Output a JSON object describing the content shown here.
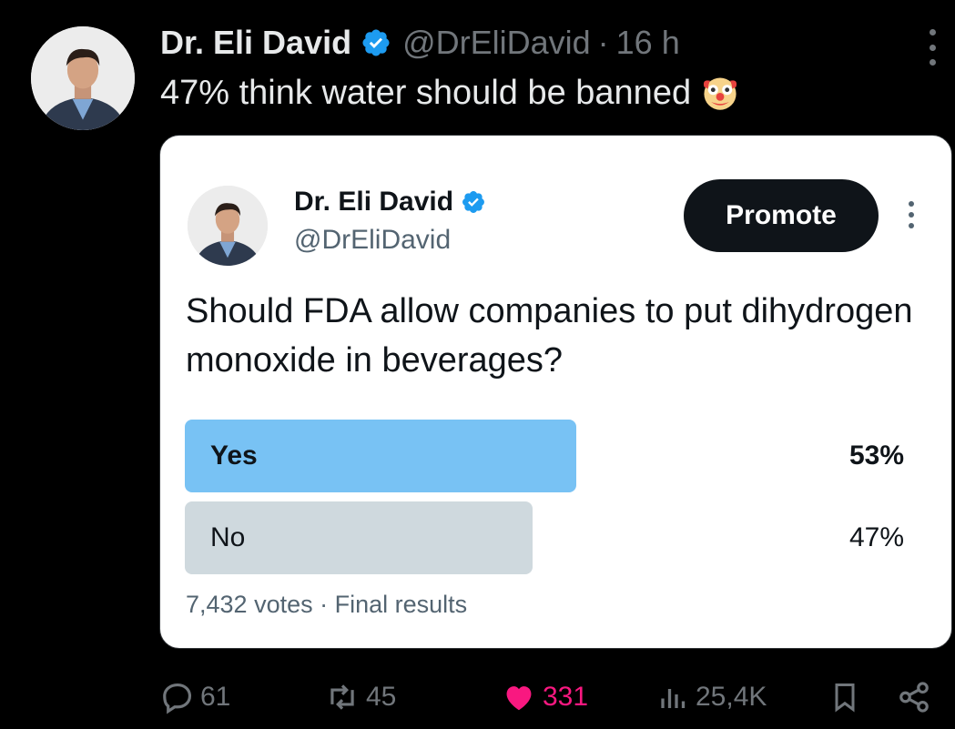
{
  "tweet": {
    "author_name": "Dr. Eli David",
    "handle": "@DrEliDavid",
    "separator": "·",
    "time": "16 h",
    "text": "47% think water should be banned"
  },
  "quoted": {
    "author_name": "Dr. Eli David",
    "handle": "@DrEliDavid",
    "promote_label": "Promote",
    "question": "Should FDA allow companies to put dihydrogen monoxide in beverages?",
    "poll": {
      "options": [
        {
          "label": "Yes",
          "percent_label": "53%",
          "percent": 53,
          "winner": true
        },
        {
          "label": "No",
          "percent_label": "47%",
          "percent": 47,
          "winner": false
        }
      ],
      "footer": "7,432 votes · Final results"
    }
  },
  "actions": {
    "replies": "61",
    "reposts": "45",
    "likes": "331",
    "views": "25,4K"
  },
  "colors": {
    "accent": "#1d9bf0",
    "like": "#f91880",
    "poll_winner": "#78c2f4",
    "poll_other": "#cfd9de"
  },
  "icons": [
    "verified-badge-icon",
    "clown-face-icon",
    "more-icon",
    "reply-icon",
    "repost-icon",
    "heart-icon",
    "views-icon",
    "bookmark-icon",
    "share-icon"
  ]
}
